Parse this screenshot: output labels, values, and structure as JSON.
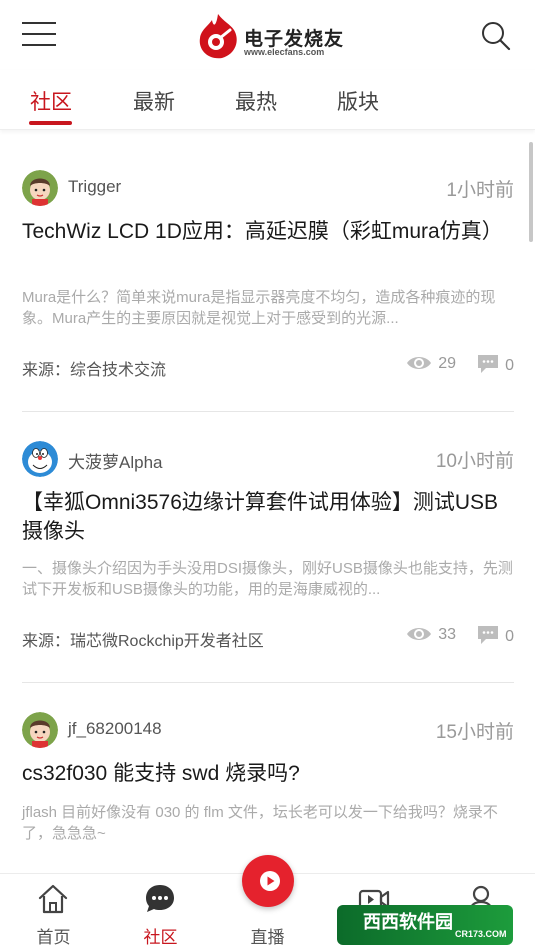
{
  "header": {
    "logo_text": "电子发烧友",
    "logo_url": "www.elecfans.com"
  },
  "tabs": [
    {
      "label": "社区",
      "active": true
    },
    {
      "label": "最新",
      "active": false
    },
    {
      "label": "最热",
      "active": false
    },
    {
      "label": "版块",
      "active": false
    }
  ],
  "posts": [
    {
      "author": "Trigger",
      "time": "1小时前",
      "title": "TechWiz LCD 1D应用：高延迟膜（彩虹mura仿真）",
      "excerpt": "Mura是什么？简单来说mura是指显示器亮度不均匀，造成各种痕迹的现象。Mura产生的主要原因就是视觉上对于感受到的光源...",
      "source": "来源：综合技术交流",
      "views": "29",
      "comments": "0",
      "avatar": "cartoon-boy-avatar"
    },
    {
      "author": "大菠萝Alpha",
      "time": "10小时前",
      "title": "【幸狐Omni3576边缘计算套件试用体验】测试USB 摄像头",
      "excerpt": "一、摄像头介绍因为手头没用DSI摄像头，刚好USB摄像头也能支持，先测试下开发板和USB摄像头的功能，用的是海康威视的...",
      "source": "来源：瑞芯微Rockchip开发者社区",
      "views": "33",
      "comments": "0",
      "avatar": "doraemon-avatar"
    },
    {
      "author": "jf_68200148",
      "time": "15小时前",
      "title": "cs32f030 能支持 swd 烧录吗?",
      "excerpt": "jflash 目前好像没有 030 的 flm 文件，坛长老可以发一下给我吗？烧录不了，急急急~",
      "avatar": "cartoon-boy-avatar"
    }
  ],
  "bottom_nav": [
    {
      "label": "首页",
      "icon": "home-icon",
      "active": false
    },
    {
      "label": "社区",
      "icon": "chat-bubble-icon",
      "active": true
    },
    {
      "label": "直播",
      "icon": "play-icon",
      "active": false
    },
    {
      "label": "视频",
      "icon": "video-camera-icon",
      "active": false
    },
    {
      "label": "我",
      "icon": "person-icon",
      "active": false
    }
  ],
  "watermark": {
    "text": "西西软件园",
    "url": "CR173.COM"
  },
  "colors": {
    "accent": "#c8161e",
    "live": "#e5222d"
  }
}
